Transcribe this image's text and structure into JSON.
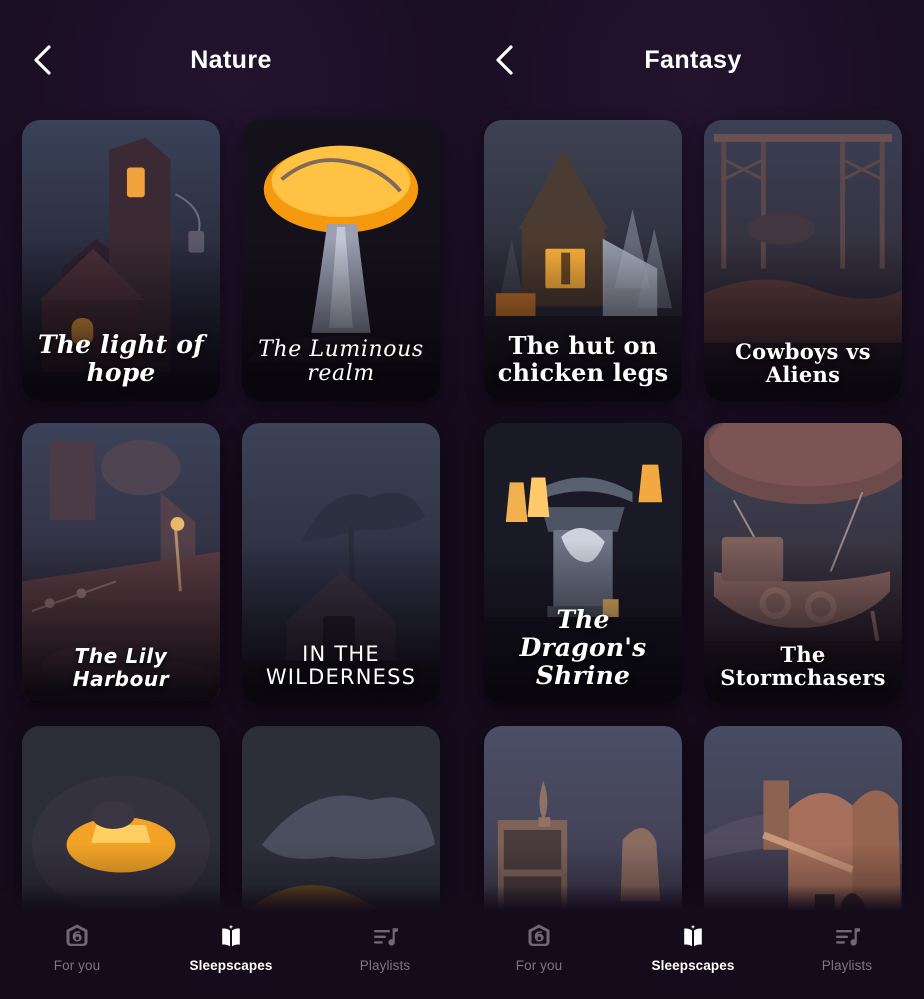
{
  "app": {
    "background_color": "#150b1c",
    "accent_color": "#ffffff"
  },
  "panels": [
    {
      "header": {
        "title": "Nature",
        "back_icon": "chevron-left-icon"
      },
      "cards": [
        {
          "title": "The light of hope",
          "style": "t-brush",
          "scene": "tower-house",
          "lines": [
            "The light of hope"
          ]
        },
        {
          "title": "The Luminous realm",
          "style": "t-script",
          "scene": "glow-mushroom",
          "lines": [
            "The Luminous realm"
          ]
        },
        {
          "title": "The Lily Harbour",
          "style": "t-bolditalic",
          "scene": "lily-harbour",
          "lines": [
            "The Lily Harbour"
          ]
        },
        {
          "title": "IN THE WILDERNESS",
          "style": "t-caps",
          "scene": "wilderness",
          "lines": [
            "IN THE WILDERNESS"
          ]
        },
        {
          "title": "",
          "style": "t-brush",
          "scene": "lantern-rock",
          "lines": []
        },
        {
          "title": "",
          "style": "t-brush",
          "scene": "ember-tree",
          "lines": []
        }
      ],
      "nav": [
        {
          "label": "For you",
          "icon": "tag-six-icon",
          "active": false
        },
        {
          "label": "Sleepscapes",
          "icon": "open-book-sparkle-icon",
          "active": true
        },
        {
          "label": "Playlists",
          "icon": "playlist-note-icon",
          "active": false
        }
      ]
    },
    {
      "header": {
        "title": "Fantasy",
        "back_icon": "chevron-left-icon"
      },
      "cards": [
        {
          "title": "The hut on chicken legs",
          "style": "t-fancy",
          "scene": "chicken-hut",
          "lines": [
            "The hut on",
            "chicken legs"
          ]
        },
        {
          "title": "Cowboys vs Aliens",
          "style": "t-serifbold",
          "scene": "cowboy-rig",
          "lines": [
            "Cowboys vs Aliens"
          ]
        },
        {
          "title": "The Dragon's Shrine",
          "style": "t-brush",
          "scene": "dragon-shrine",
          "lines": [
            "The Dragon's",
            "Shrine"
          ]
        },
        {
          "title": "The Stormchasers",
          "style": "t-serifbold",
          "scene": "airship",
          "lines": [
            "The Stormchasers"
          ]
        },
        {
          "title": "",
          "style": "t-brush",
          "scene": "alchemy-shelf",
          "lines": []
        },
        {
          "title": "",
          "style": "t-brush",
          "scene": "crooked-house",
          "lines": []
        }
      ],
      "nav": [
        {
          "label": "For you",
          "icon": "tag-six-icon",
          "active": false
        },
        {
          "label": "Sleepscapes",
          "icon": "open-book-sparkle-icon",
          "active": true
        },
        {
          "label": "Playlists",
          "icon": "playlist-note-icon",
          "active": false
        }
      ]
    }
  ]
}
